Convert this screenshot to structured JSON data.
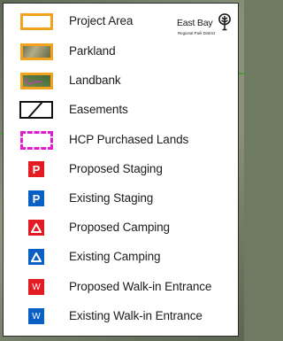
{
  "colors": {
    "project_area_outline": "#f2a21c",
    "hcp_outline": "#e21bd0",
    "proposed_red": "#e31b23",
    "existing_blue": "#0a5fc4"
  },
  "logo": {
    "name": "East Bay",
    "subtitle": "Regional Park District",
    "icon": "tree-icon"
  },
  "legend": {
    "items": [
      {
        "label": "Project Area",
        "symbol": "orange-outline-box"
      },
      {
        "label": "Parkland",
        "symbol": "orange-outline-texture-box"
      },
      {
        "label": "Landbank",
        "symbol": "orange-outline-green-box"
      },
      {
        "label": "Easements",
        "symbol": "hatched-box"
      },
      {
        "label": "HCP Purchased Lands",
        "symbol": "magenta-dashed-box"
      },
      {
        "label": "Proposed Staging",
        "symbol": "P",
        "icon": "proposed-staging-icon"
      },
      {
        "label": "Existing Staging",
        "symbol": "P",
        "icon": "existing-staging-icon"
      },
      {
        "label": "Proposed Camping",
        "symbol": "tent-triangle",
        "icon": "proposed-camping-icon"
      },
      {
        "label": "Existing Camping",
        "symbol": "tent-triangle",
        "icon": "existing-camping-icon"
      },
      {
        "label": "Proposed Walk-in Entrance",
        "symbol": "W",
        "icon": "proposed-walkin-icon"
      },
      {
        "label": "Existing Walk-in Entrance",
        "symbol": "W",
        "icon": "existing-walkin-icon"
      }
    ]
  }
}
